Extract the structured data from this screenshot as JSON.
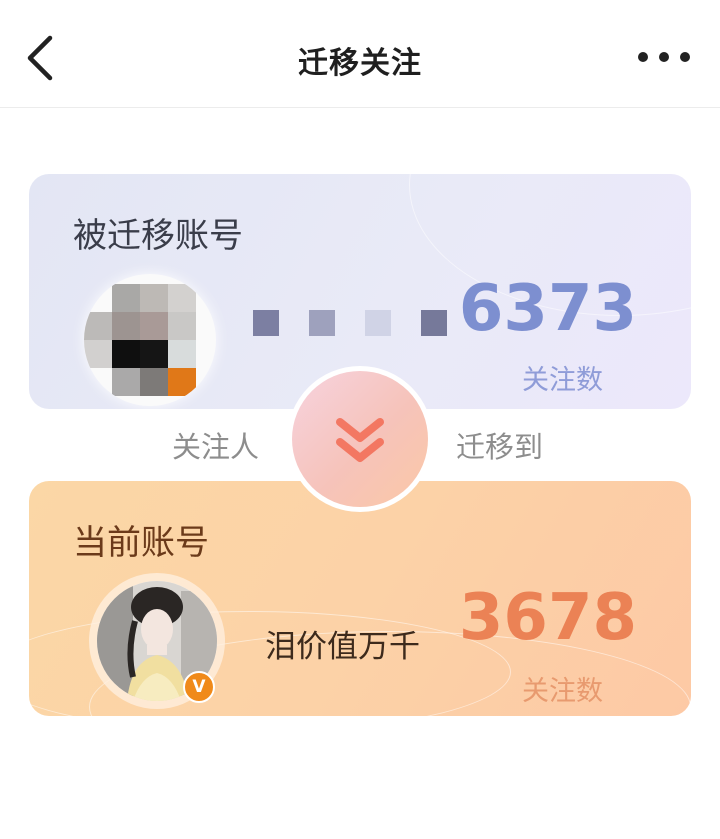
{
  "header": {
    "title": "迁移关注",
    "back_icon": "chevron-left-icon",
    "more_icon": "more-horizontal-icon"
  },
  "source_account": {
    "label": "被迁移账号",
    "following_count": "6373",
    "count_label": "关注数"
  },
  "transfer": {
    "left_label": "关注人",
    "right_label": "迁移到",
    "icon": "double-chevron-down-icon"
  },
  "current_account": {
    "label": "当前账号",
    "name": "泪价值万千",
    "following_count": "3678",
    "count_label": "关注数",
    "verified_badge": "V"
  },
  "colors": {
    "source_count": "#7d8fd0",
    "current_count": "#eb8255",
    "verified": "#f08a1a"
  }
}
